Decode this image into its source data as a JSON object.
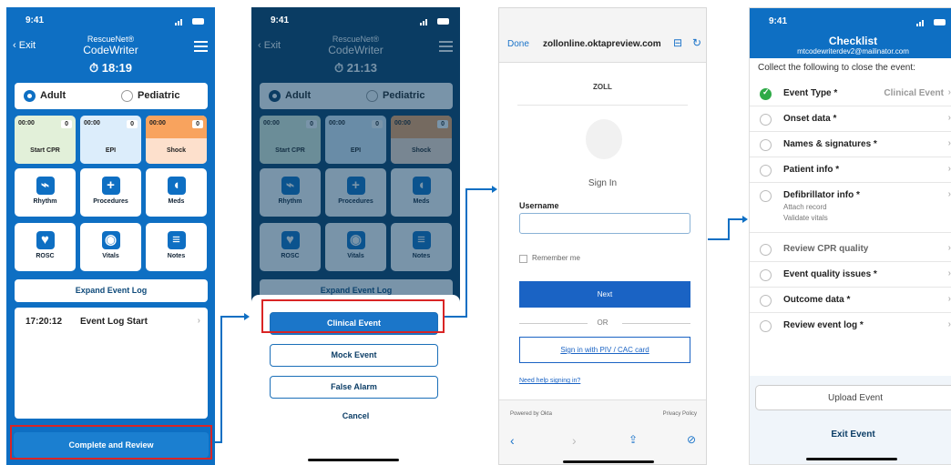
{
  "phone1": {
    "time": "9:41",
    "back": "Exit",
    "brand": "RescueNet®",
    "app": "CodeWriter",
    "timer": "18:19",
    "adult": "Adult",
    "pediatric": "Pediatric",
    "timers": [
      {
        "t": "00:00",
        "n": "0",
        "label": "Start CPR"
      },
      {
        "t": "00:00",
        "n": "0",
        "label": "EPI"
      },
      {
        "t": "00:00",
        "n": "0",
        "label": "Shock"
      }
    ],
    "tiles": [
      "Rhythm",
      "Procedures",
      "Meds",
      "ROSC",
      "Vitals",
      "Notes"
    ],
    "expand": "Expand Event Log",
    "log_time": "17:20:12",
    "log_text": "Event Log Start",
    "complete": "Complete and Review"
  },
  "phone2": {
    "time": "9:41",
    "back": "Exit",
    "brand": "RescueNet®",
    "app": "CodeWriter",
    "timer": "21:13",
    "adult": "Adult",
    "pediatric": "Pediatric",
    "timers": [
      {
        "t": "00:00",
        "n": "0",
        "label": "Start CPR"
      },
      {
        "t": "00:00",
        "n": "0",
        "label": "EPI"
      },
      {
        "t": "00:00",
        "n": "0",
        "label": "Shock"
      }
    ],
    "tiles": [
      "Rhythm",
      "Procedures",
      "Meds",
      "ROSC",
      "Vitals",
      "Notes"
    ],
    "expand": "Expand Event Log",
    "clinical": "Clinical Event",
    "mock": "Mock Event",
    "false": "False Alarm",
    "cancel": "Cancel"
  },
  "phone3": {
    "done": "Done",
    "url": "zollonline.oktapreview.com",
    "logo": "ZOLL",
    "signin": "Sign In",
    "username": "Username",
    "remember": "Remember me",
    "next": "Next",
    "or": "OR",
    "piv": "Sign in with PIV / CAC card",
    "help": "Need help signing in?",
    "powered": "Powered by Okta",
    "privacy": "Privacy Policy"
  },
  "phone4": {
    "time": "9:41",
    "title": "Checklist",
    "email": "mtcodewriterdev2@mailinator.com",
    "intro": "Collect the following to close the event:",
    "items": [
      {
        "label": "Event Type *",
        "value": "Clinical Event"
      },
      {
        "label": "Onset data *"
      },
      {
        "label": "Names & signatures *"
      },
      {
        "label": "Patient info *"
      },
      {
        "label": "Defibrillator info *",
        "sub1": "Attach record",
        "sub2": "Validate vitals"
      },
      {
        "label": "Review CPR quality"
      },
      {
        "label": "Event quality issues *"
      },
      {
        "label": "Outcome data *"
      },
      {
        "label": "Review event log *"
      }
    ],
    "upload": "Upload Event",
    "exit": "Exit Event"
  },
  "colors": {
    "primary": "#0e6fc3",
    "highlight": "#d92525",
    "check": "#2eaa47"
  }
}
